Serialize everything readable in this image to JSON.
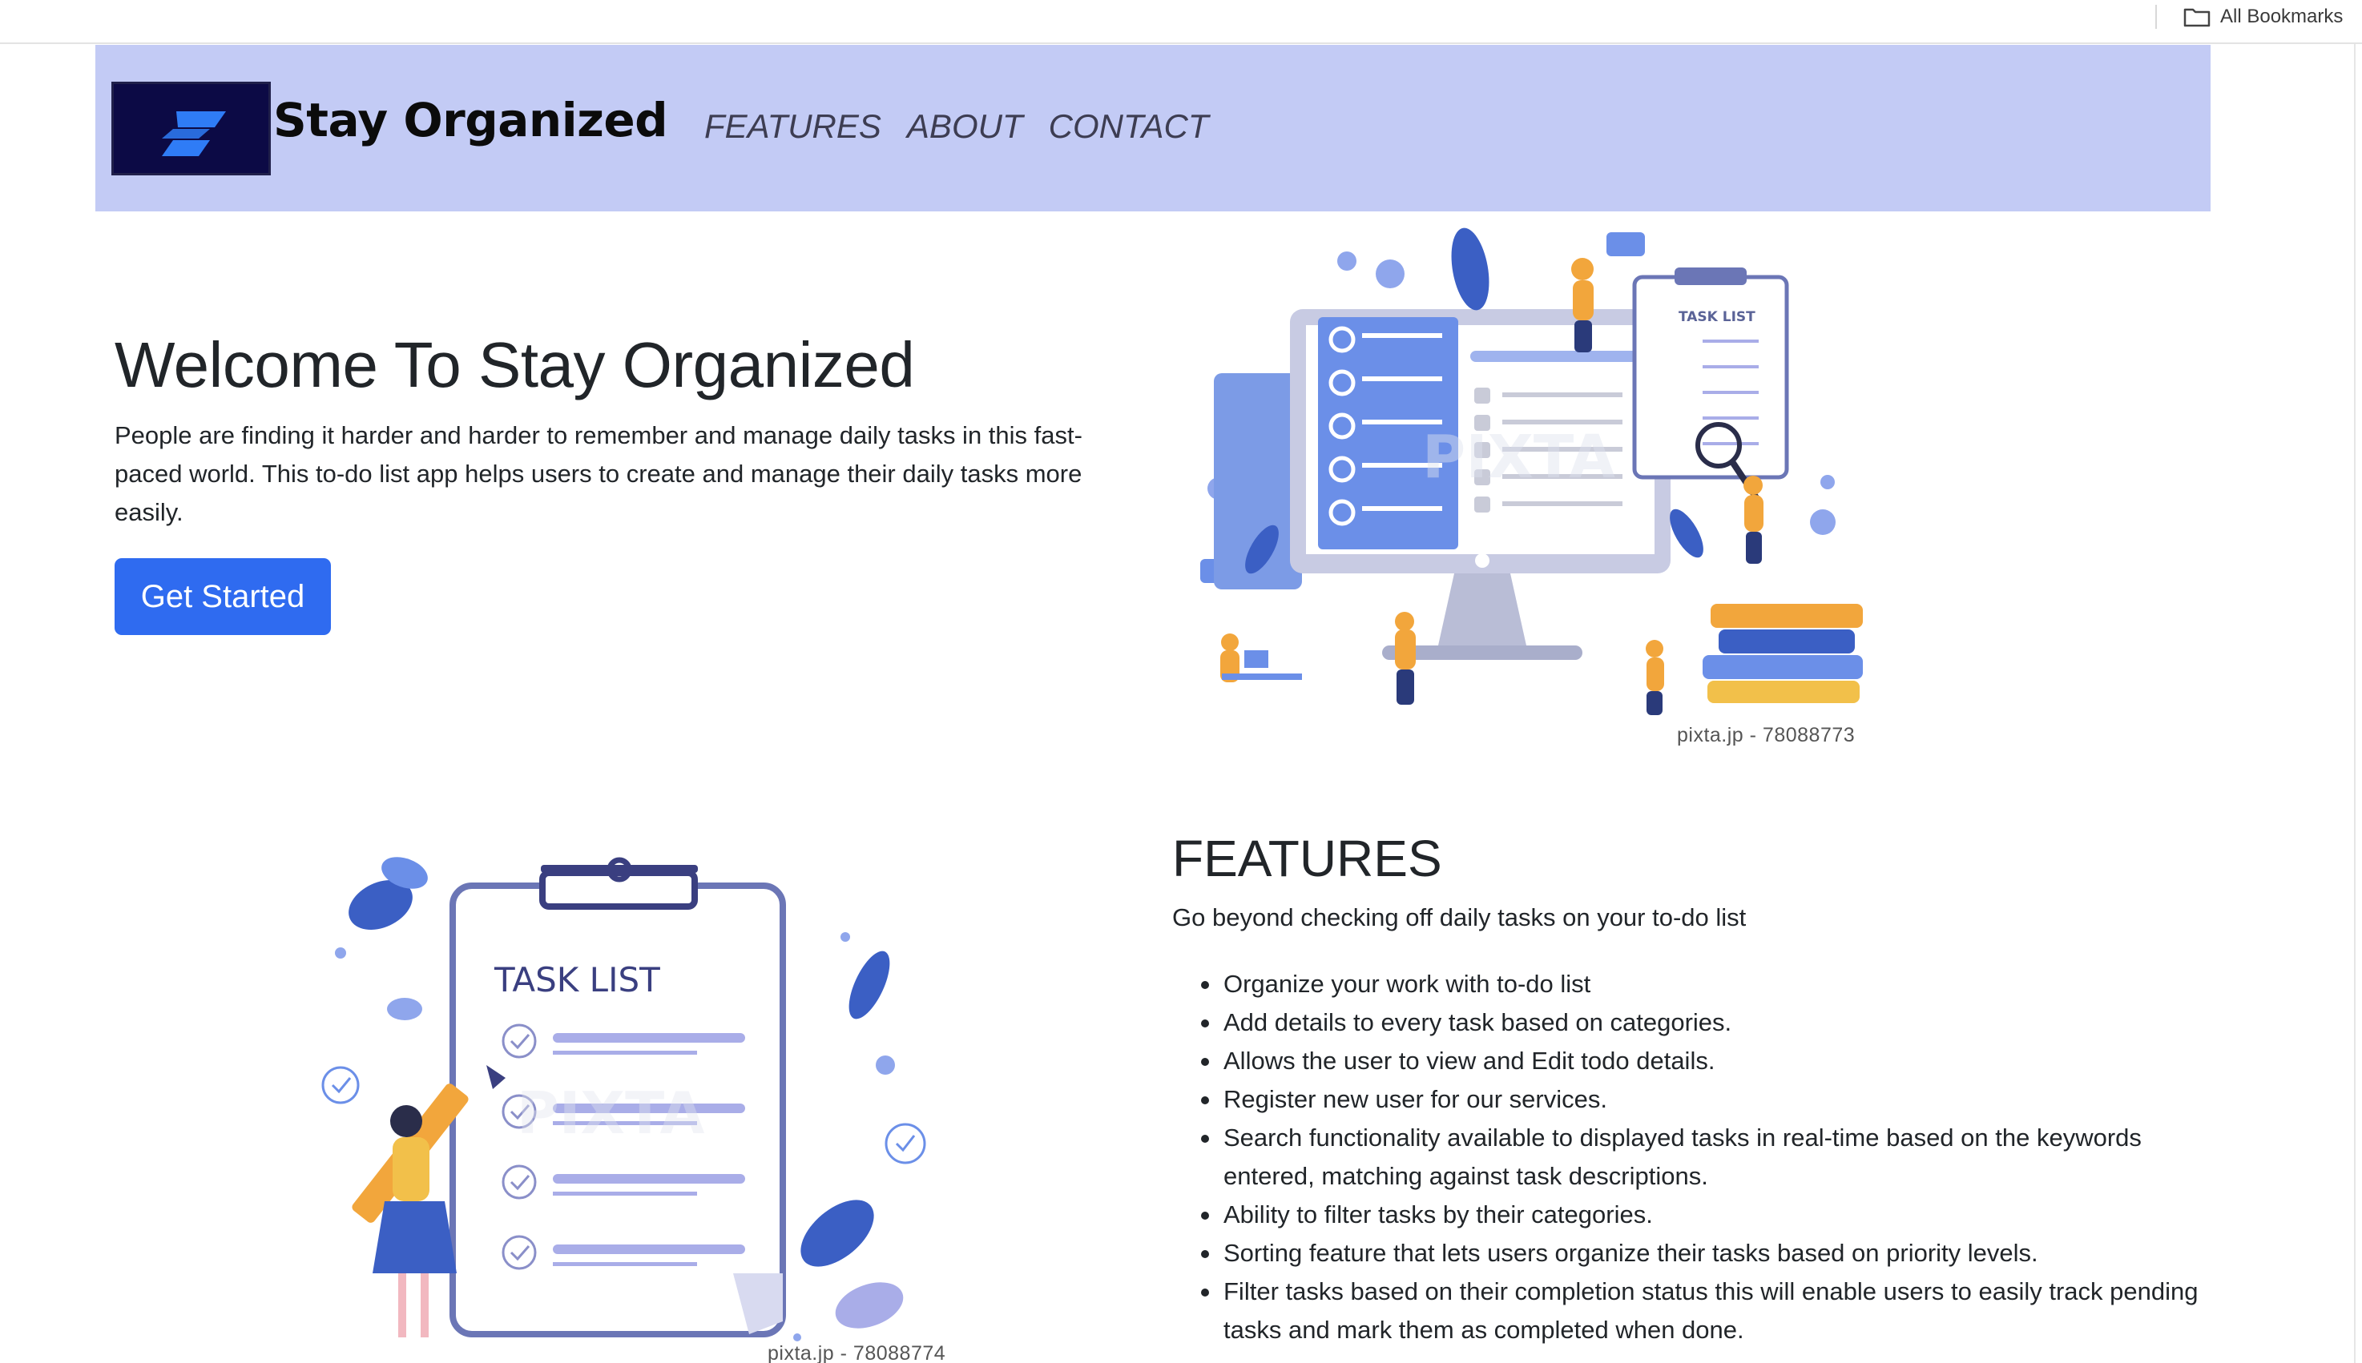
{
  "browser": {
    "bookmarks_label": "All Bookmarks"
  },
  "header": {
    "brand": "Stay Organized",
    "nav": [
      "FEATURES",
      "ABOUT",
      "CONTACT"
    ]
  },
  "hero": {
    "title": "Welcome To Stay Organized",
    "description": "People are finding it harder and harder to remember and manage daily tasks in this fast-paced world. This to-do list app helps users to create and manage their daily tasks more easily.",
    "cta_label": "Get Started",
    "illustration_credit": "pixta.jp - 78088773",
    "illustration_caption": "TASK LIST"
  },
  "features": {
    "title": "FEATURES",
    "subtitle": "Go beyond checking off daily tasks on your to-do list",
    "items": [
      "Organize your work with to-do list",
      "Add details to every task based on categories.",
      "Allows the user to view and Edit todo details.",
      "Register new user for our services.",
      "Search functionality available to displayed tasks in real-time based on the keywords entered, matching against task descriptions.",
      "Ability to filter tasks by their categories.",
      "Sorting feature that lets users organize their tasks based on priority levels.",
      "Filter tasks based on their completion status this will enable users to easily track pending tasks and mark them as completed when done."
    ],
    "illustration_caption": "TASK LIST",
    "illustration_credit": "pixta.jp - 78088774"
  },
  "colors": {
    "header_bg": "#c3cbf5",
    "logo_bg": "#0c0a45",
    "logo_mark": "#2f7cf6",
    "button_bg": "#2f6bf0",
    "illustration_blue": "#6b8fe8",
    "illustration_purple": "#a9ade8",
    "illustration_orange": "#f2a63c"
  },
  "icons": [
    "folder-icon",
    "logo-s-icon",
    "check-icon",
    "gear-icon",
    "magnifier-icon",
    "pencil-icon",
    "leaf-icon"
  ]
}
